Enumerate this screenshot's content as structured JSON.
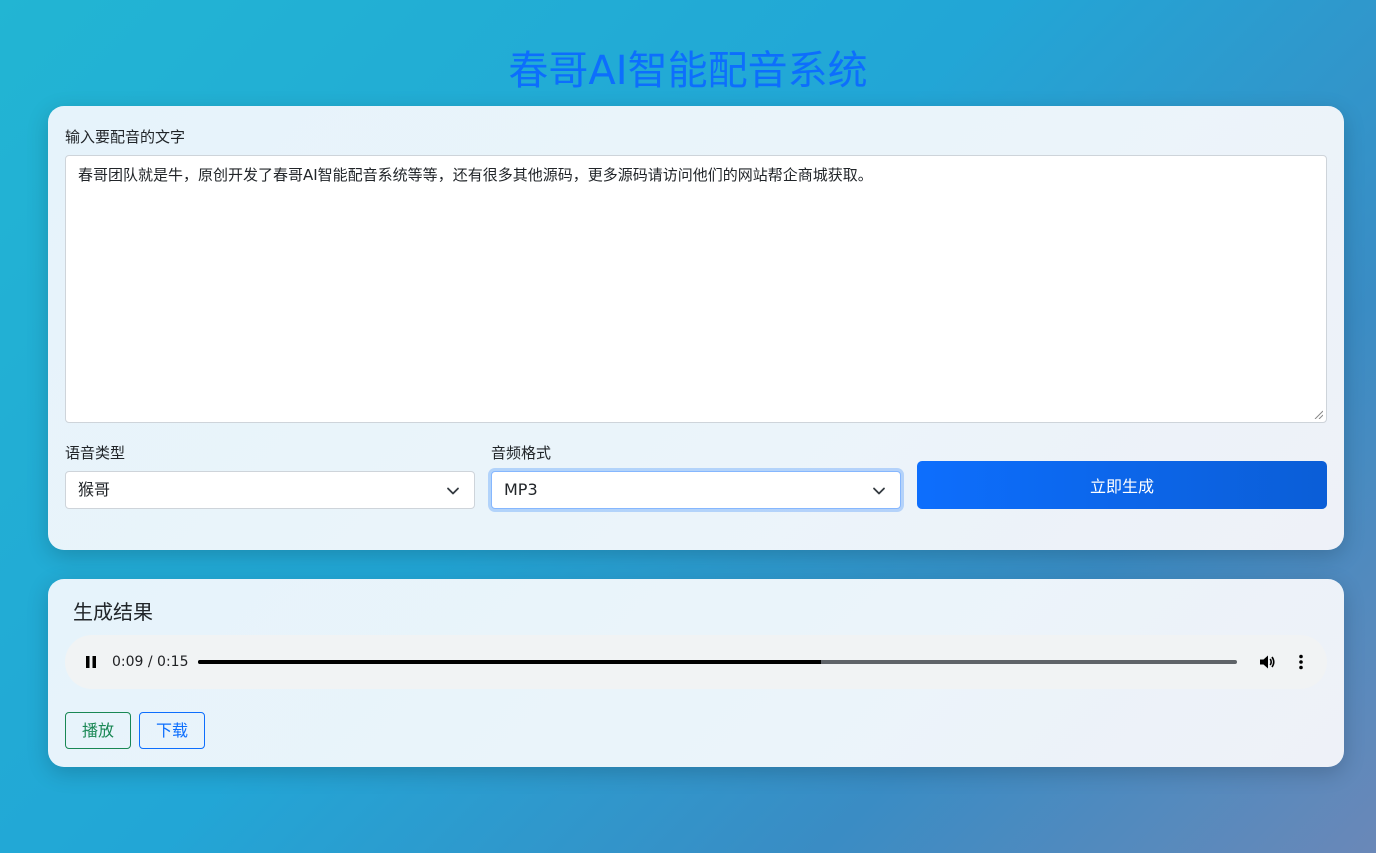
{
  "page": {
    "title": "春哥AI智能配音系统"
  },
  "form": {
    "text_label": "输入要配音的文字",
    "text_value": "春哥团队就是牛，原创开发了春哥AI智能配音系统等等，还有很多其他源码，更多源码请访问他们的网站帮企商城获取。",
    "voice_label": "语音类型",
    "voice_value": "猴哥",
    "format_label": "音频格式",
    "format_value": "MP3",
    "generate_label": "立即生成"
  },
  "result": {
    "title": "生成结果",
    "audio": {
      "time": "0:09 / 0:15",
      "progress": 0.6
    },
    "play_label": "播放",
    "download_label": "下载"
  },
  "colors": {
    "primary": "#0d6efd",
    "success": "#198754"
  }
}
